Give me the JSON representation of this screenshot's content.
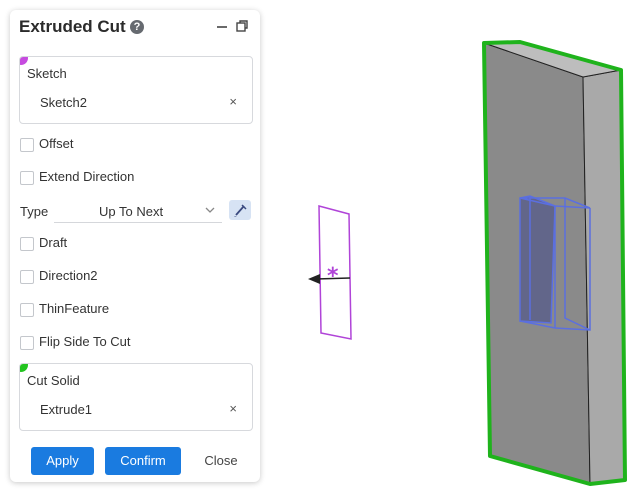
{
  "panel": {
    "title": "Extruded Cut",
    "help_glyph": "?",
    "sketch_group": {
      "label": "Sketch",
      "value": "Sketch2",
      "clear_glyph": "×",
      "marker_color": "#c64bdf"
    },
    "options": [
      {
        "label": "Offset",
        "checked": false
      },
      {
        "label": "Extend Direction",
        "checked": false
      }
    ],
    "type": {
      "label": "Type",
      "value": "Up To Next"
    },
    "options2": [
      {
        "label": "Draft",
        "checked": false
      },
      {
        "label": "Direction2",
        "checked": false
      },
      {
        "label": "ThinFeature",
        "checked": false
      },
      {
        "label": "Flip Side To Cut",
        "checked": false
      }
    ],
    "cut_group": {
      "label": "Cut Solid",
      "value": "Extrude1",
      "clear_glyph": "×",
      "marker_color": "#22c41f"
    },
    "buttons": {
      "apply": "Apply",
      "confirm": "Confirm",
      "close": "Close"
    }
  },
  "icons": {
    "help": "help-icon",
    "minimize": "minimize-icon",
    "restore": "restore-window-icon",
    "chevron": "chevron-down-icon",
    "pick": "pick-pen-icon"
  },
  "colors": {
    "accent": "#1a7be0",
    "sketch_outline": "#b044d8",
    "solid_outline": "#1fb31c",
    "cut_preview": "#5b6fe0"
  }
}
